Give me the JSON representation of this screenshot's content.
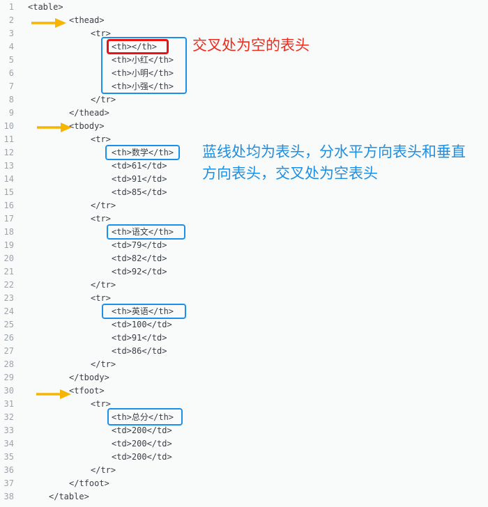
{
  "lines": [
    {
      "n": "1",
      "text": "<table>"
    },
    {
      "n": "2",
      "text": "<thead>"
    },
    {
      "n": "3",
      "text": "<tr>"
    },
    {
      "n": "4",
      "text": "<th></th>"
    },
    {
      "n": "5",
      "text": "<th>小红</th>"
    },
    {
      "n": "6",
      "text": "<th>小明</th>"
    },
    {
      "n": "7",
      "text": "<th>小强</th>"
    },
    {
      "n": "8",
      "text": "</tr>"
    },
    {
      "n": "9",
      "text": "</thead>"
    },
    {
      "n": "10",
      "text": "<tbody>"
    },
    {
      "n": "11",
      "text": "<tr>"
    },
    {
      "n": "12",
      "text": "<th>数学</th>"
    },
    {
      "n": "13",
      "text": "<td>61</td>"
    },
    {
      "n": "14",
      "text": "<td>91</td>"
    },
    {
      "n": "15",
      "text": "<td>85</td>"
    },
    {
      "n": "16",
      "text": "</tr>"
    },
    {
      "n": "17",
      "text": "<tr>"
    },
    {
      "n": "18",
      "text": "<th>语文</th>"
    },
    {
      "n": "19",
      "text": "<td>79</td>"
    },
    {
      "n": "20",
      "text": "<td>82</td>"
    },
    {
      "n": "21",
      "text": "<td>92</td>"
    },
    {
      "n": "22",
      "text": "</tr>"
    },
    {
      "n": "23",
      "text": "<tr>"
    },
    {
      "n": "24",
      "text": "<th>英语</th>"
    },
    {
      "n": "25",
      "text": "<td>100</td>"
    },
    {
      "n": "26",
      "text": "<td>91</td>"
    },
    {
      "n": "27",
      "text": "<td>86</td>"
    },
    {
      "n": "28",
      "text": "</tr>"
    },
    {
      "n": "29",
      "text": "</tbody>"
    },
    {
      "n": "30",
      "text": "<tfoot>"
    },
    {
      "n": "31",
      "text": "<tr>"
    },
    {
      "n": "32",
      "text": "<th>总分</th>"
    },
    {
      "n": "33",
      "text": "<td>200</td>"
    },
    {
      "n": "34",
      "text": "<td>200</td>"
    },
    {
      "n": "35",
      "text": "<td>200</td>"
    },
    {
      "n": "36",
      "text": "</tr>"
    },
    {
      "n": "37",
      "text": "</tfoot>"
    },
    {
      "n": "38",
      "text": "</table>"
    }
  ],
  "annotations": {
    "red_note": "交叉处为空的表头",
    "blue_note": "蓝线处均为表头，分水平方向表头和垂直方向表头，交叉处为空表头"
  },
  "colors": {
    "arrow": "#f7b400",
    "highlight_blue": "#1a90ee",
    "highlight_red": "#ee1111"
  }
}
